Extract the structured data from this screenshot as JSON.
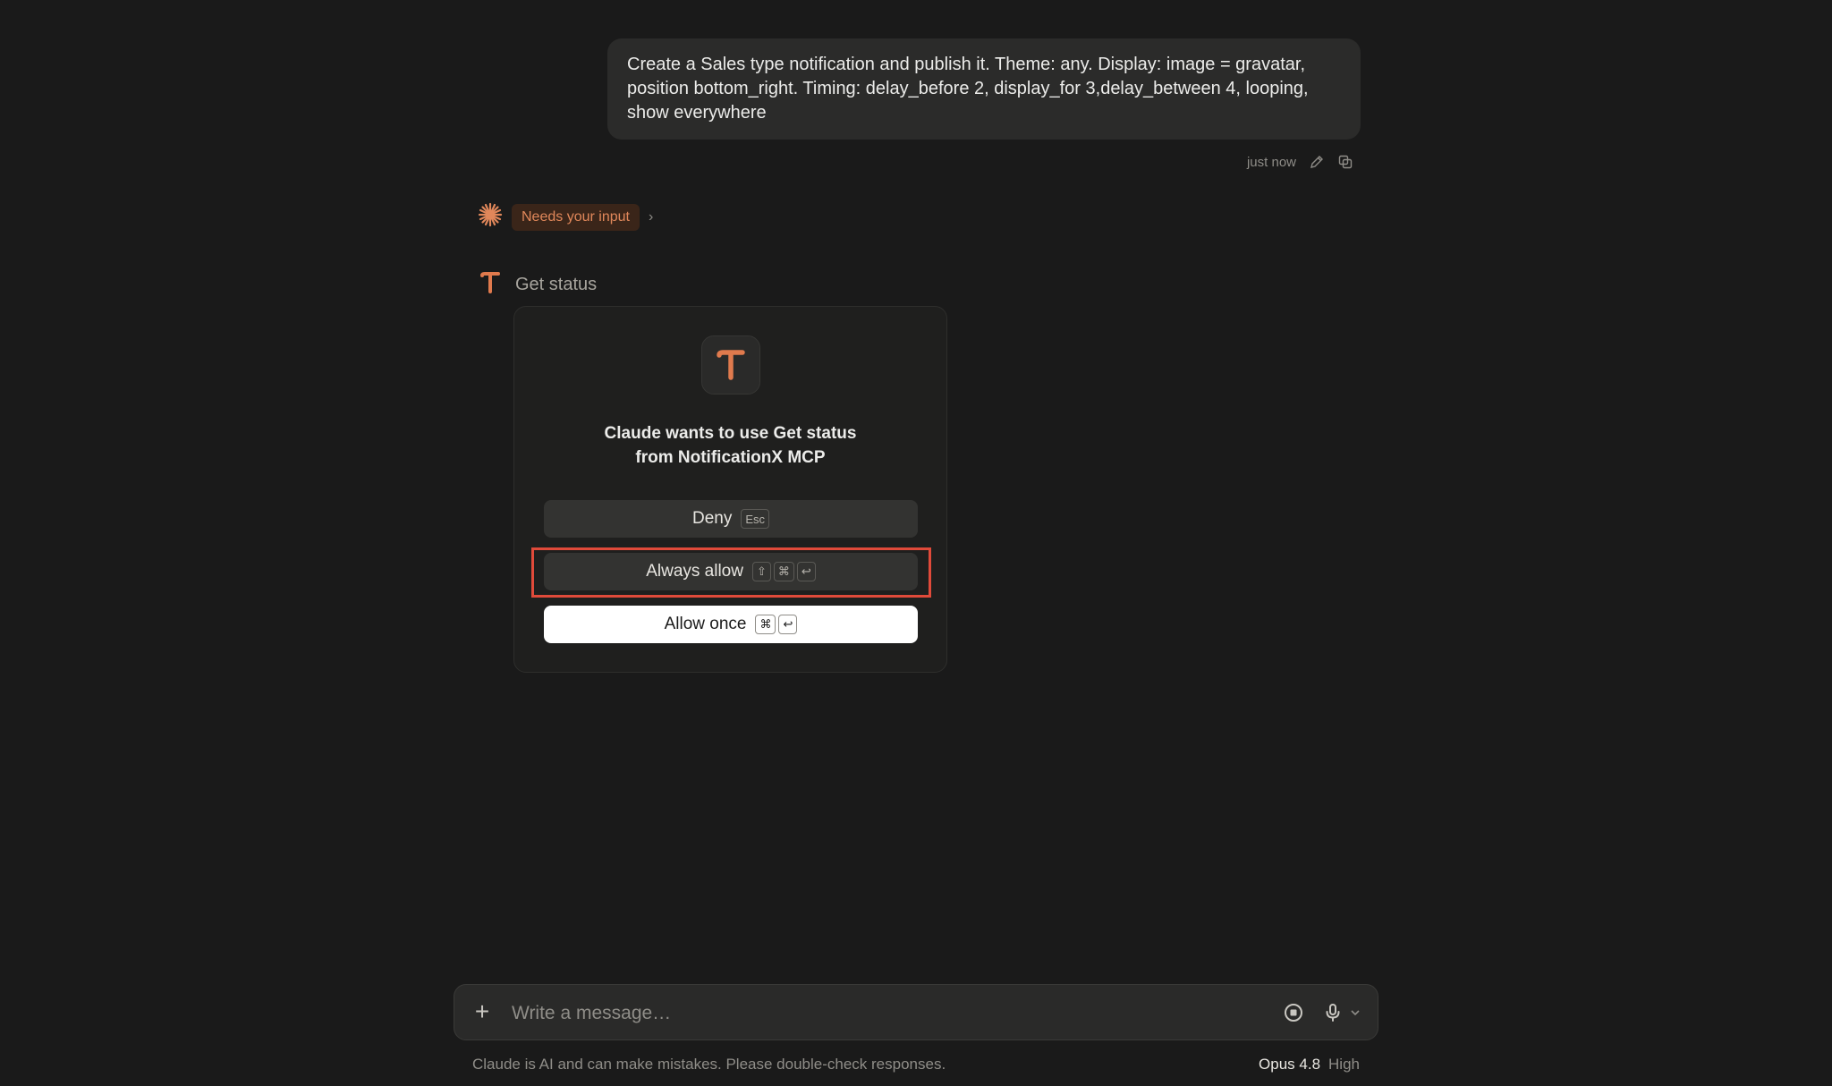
{
  "user_message": {
    "text": "Create a Sales type notification and publish it. Theme: any. Display: image = gravatar, position bottom_right. Timing: delay_before 2, display_for 3,delay_between 4, looping, show everywhere",
    "timestamp": "just now",
    "icons": [
      "edit-icon",
      "copy-icon"
    ]
  },
  "status": {
    "pill": "Needs your input",
    "accent_color": "#e0875a"
  },
  "tool": {
    "title": "Get status",
    "icon": "mcp-app-icon"
  },
  "permission": {
    "prompt": "Claude wants to use Get status from NotificationX MCP",
    "deny": {
      "label": "Deny",
      "keys": [
        "Esc"
      ]
    },
    "always_allow": {
      "label": "Always allow",
      "keys": [
        "⇧",
        "⌘",
        "↩"
      ]
    },
    "allow_once": {
      "label": "Allow once",
      "keys": [
        "⌘",
        "↩"
      ]
    },
    "highlight_color": "#e04a3a"
  },
  "composer": {
    "placeholder": "Write a message…",
    "icons": [
      "plus-icon",
      "stop-icon",
      "microphone-icon",
      "chevron-down-icon"
    ]
  },
  "footer": {
    "disclaimer": "Claude is AI and can make mistakes. Please double-check responses.",
    "model": "Opus 4.8",
    "effort": "High"
  }
}
